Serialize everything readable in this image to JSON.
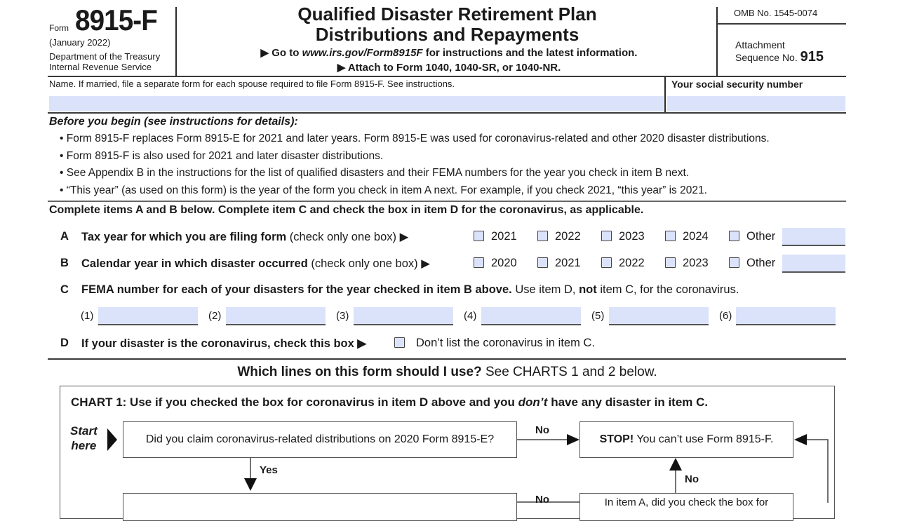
{
  "header": {
    "form_word": "Form",
    "form_number": "8915-F",
    "revision_date": "(January 2022)",
    "department": "Department of the Treasury",
    "agency": "Internal Revenue Service",
    "title_line1": "Qualified Disaster Retirement Plan",
    "title_line2": "Distributions and Repayments",
    "goto_prefix": "▶ Go to ",
    "goto_url": "www.irs.gov/Form8915F",
    "goto_suffix": " for instructions and the latest information.",
    "attach_line": "▶ Attach to Form 1040, 1040-SR, or 1040-NR.",
    "omb": "OMB No. 1545-0074",
    "attachment_line1": "Attachment",
    "attachment_line2": "Sequence No.",
    "sequence_no": "915"
  },
  "name_row": {
    "name_label": "Name. If married, file a separate form for each spouse required to file Form 8915-F. See instructions.",
    "name_value": "",
    "ssn_label": "Your social security number",
    "ssn_value": ""
  },
  "before_you_begin": {
    "heading": "Before you begin (see instructions for details):",
    "bullets": [
      "• Form 8915-F replaces Form 8915-E for 2021 and later years. Form 8915-E was used for coronavirus-related and other 2020 disaster distributions.",
      "• Form 8915-F is also used for 2021 and later disaster distributions.",
      "• See Appendix B in the instructions for the list of qualified disasters and their FEMA numbers for the year you check in item B next.",
      "• “This year” (as used on this form) is the year of the form you check in item A next. For example, if you check 2021, “this year” is 2021."
    ]
  },
  "items": {
    "intro": "Complete items A and B below. Complete item C and check the box in item D for the coronavirus, as applicable.",
    "A": {
      "letter": "A",
      "label_bold": "Tax year for which you are filing form",
      "label_rest": " (check only one box) ▶",
      "options": [
        "2021",
        "2022",
        "2023",
        "2024",
        "Other"
      ],
      "other_value": ""
    },
    "B": {
      "letter": "B",
      "label_bold": "Calendar year in which disaster occurred",
      "label_rest": " (check only one box) ▶",
      "options": [
        "2020",
        "2021",
        "2022",
        "2023",
        "Other"
      ],
      "other_value": ""
    },
    "C": {
      "letter": "C",
      "label_bold": "FEMA number for each of your disasters for the year checked in item B above.",
      "label_mid": " Use item D, ",
      "label_not": "not",
      "label_end": " item C, for the coronavirus.",
      "fields": [
        "(1)",
        "(2)",
        "(3)",
        "(4)",
        "(5)",
        "(6)"
      ]
    },
    "D": {
      "letter": "D",
      "label_bold": "If your disaster is the coronavirus, check this box ▶",
      "note": "Don’t list the coronavirus in item C."
    }
  },
  "which_lines": {
    "bold": "Which lines on this form should I use?",
    "rest": " See CHARTS 1 and 2 below."
  },
  "chart1": {
    "title_a": "CHART 1: Use if you checked the box for coronavirus in item D above and you ",
    "title_em": "don’t",
    "title_b": " have any disaster in item C.",
    "start_line1": "Start",
    "start_line2": "here",
    "q1": "Did you claim coronavirus-related distributions on 2020 Form 8915-E?",
    "stop_bold": "STOP!",
    "stop_rest": " You can’t use Form 8915-F.",
    "no_label": "No",
    "yes_label": "Yes",
    "q3_partial": "In item A, did you check the box for"
  }
}
